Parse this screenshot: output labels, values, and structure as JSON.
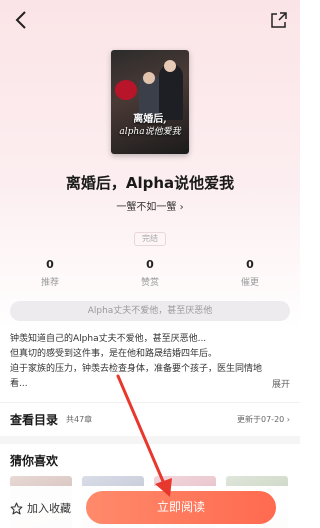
{
  "book": {
    "title": "离婚后，Alpha说他爱我",
    "author": "一蟹不如一蟹",
    "author_chevron": "›",
    "status": "完结",
    "cover": {
      "title_line1": "离婚后,",
      "title_line2": "alpha说他爱我"
    }
  },
  "stats": [
    {
      "value": "0",
      "label": "推荐"
    },
    {
      "value": "0",
      "label": "赞赏"
    },
    {
      "value": "0",
      "label": "催更"
    }
  ],
  "tag": "Alpha丈夫不爱他，甚至厌恶他",
  "synopsis": {
    "lines": [
      "钟羡知道自己的Alpha丈夫不爱他，甚至厌恶他...",
      "但真切的感受到这件事，是在他和路晟结婚四年后。",
      "迫于家族的压力，钟羡去检查身体，准备要个孩子，医生同情地",
      "看..."
    ],
    "expand_label": "展开"
  },
  "toc": {
    "title": "查看目录",
    "count": "共47章",
    "update": "更新于07-20",
    "chevron": "›"
  },
  "recommend": {
    "title": "猜你喜欢"
  },
  "bottom": {
    "favorite_label": "加入收藏",
    "read_label": "立即阅读"
  },
  "colors": {
    "accent": "#ff7256",
    "annotation_arrow": "#e8382d"
  },
  "icons": {
    "back": "back-icon",
    "share": "share-icon",
    "favorite": "star-icon"
  }
}
